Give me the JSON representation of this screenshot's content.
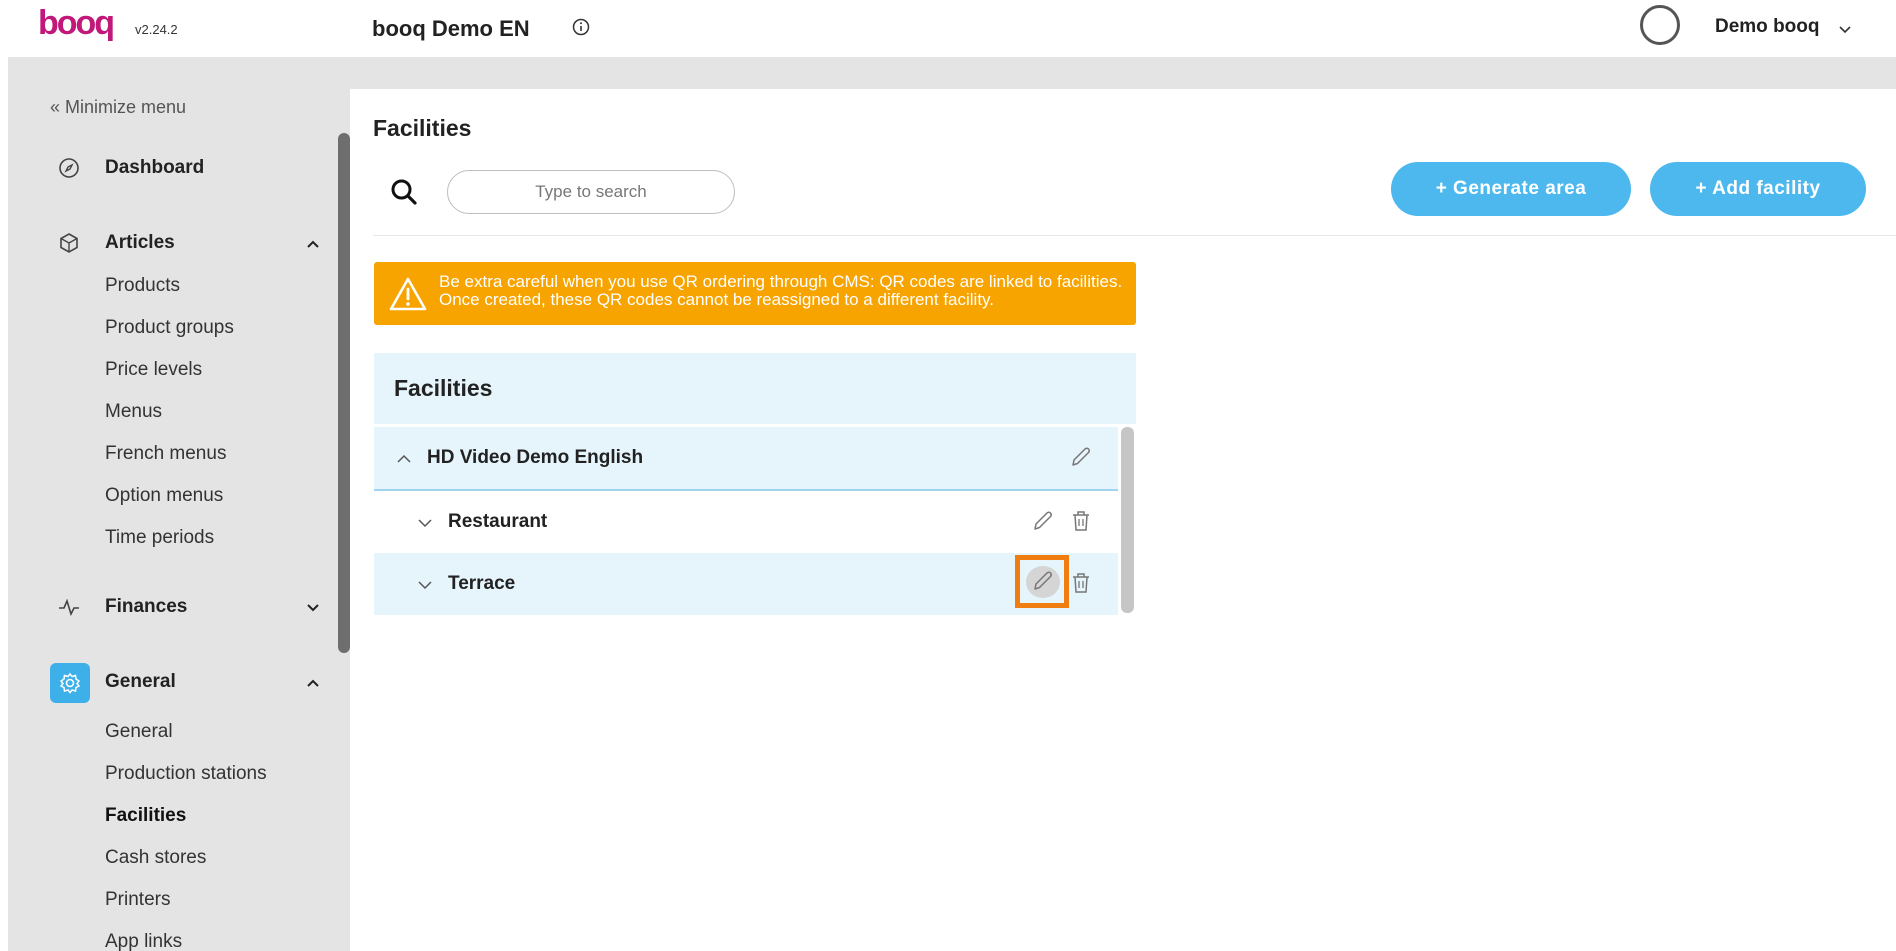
{
  "app": {
    "version": "v2.24.2",
    "org_title": "booq Demo EN",
    "user_name": "Demo booq",
    "accent_color": "#4db8ee",
    "warning_color": "#f7a300",
    "highlight_color": "#f07d10"
  },
  "sidebar": {
    "minimize_label": "« Minimize menu",
    "dashboard": "Dashboard",
    "articles": {
      "label": "Articles",
      "items": [
        "Products",
        "Product groups",
        "Price levels",
        "Menus",
        "French menus",
        "Option menus",
        "Time periods"
      ]
    },
    "finances": {
      "label": "Finances"
    },
    "general": {
      "label": "General",
      "items": [
        "General",
        "Production stations",
        "Facilities",
        "Cash stores",
        "Printers",
        "App links"
      ],
      "current": "Facilities"
    }
  },
  "main": {
    "page_title": "Facilities",
    "search_placeholder": "Type to search",
    "generate_area_label": "+ Generate area",
    "add_facility_label": "+ Add facility",
    "warning_text": "Be extra careful when you use QR ordering through CMS: QR codes are linked to facilities. Once created, these QR codes cannot be reassigned to a different facility.",
    "facilities_header": "Facilities",
    "rows": [
      {
        "name": "HD Video Demo English",
        "expanded": true
      },
      {
        "name": "Restaurant",
        "expanded": false
      },
      {
        "name": "Terrace",
        "expanded": false
      }
    ]
  }
}
